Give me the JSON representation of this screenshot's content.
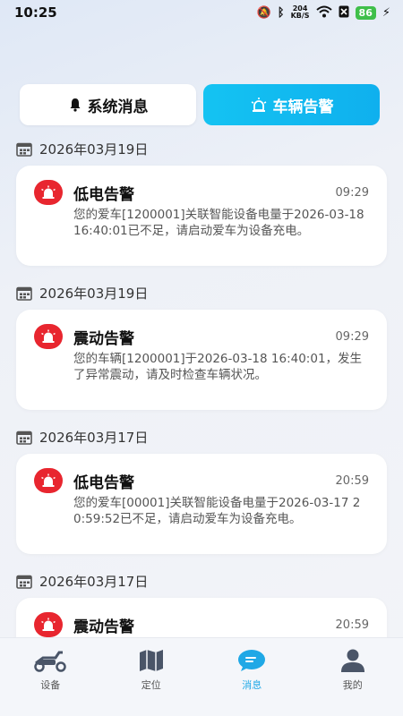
{
  "status": {
    "time": "10:25",
    "net_speed_top": "204",
    "net_speed_bottom": "KB/S",
    "battery": "86"
  },
  "tabs": [
    {
      "label": "系统消息",
      "icon": "bell-icon",
      "active": false
    },
    {
      "label": "车辆告警",
      "icon": "alarm-light-icon",
      "active": true
    }
  ],
  "groups": [
    {
      "date": "2026年03月19日",
      "title": "低电告警",
      "time": "09:29",
      "body": "您的爱车[1200001]关联智能设备电量于2026-03-18 16:40:01已不足，请启动爱车为设备充电。"
    },
    {
      "date": "2026年03月19日",
      "title": "震动告警",
      "time": "09:29",
      "body": "您的车辆[1200001]于2026-03-18 16:40:01，发生了异常震动，请及时检查车辆状况。"
    },
    {
      "date": "2026年03月17日",
      "title": "低电告警",
      "time": "20:59",
      "body": "您的爱车[00001]关联智能设备电量于2026-03-17 20:59:52已不足，请启动爱车为设备充电。"
    },
    {
      "date": "2026年03月17日",
      "title": "震动告警",
      "time": "20:59",
      "body": ""
    }
  ],
  "nav": [
    {
      "label": "设备",
      "icon": "scooter-icon",
      "active": false
    },
    {
      "label": "定位",
      "icon": "map-icon",
      "active": false
    },
    {
      "label": "消息",
      "icon": "message-icon",
      "active": true
    },
    {
      "label": "我的",
      "icon": "user-icon",
      "active": false
    }
  ],
  "colors": {
    "accent": "#14c3f2",
    "alarm": "#e8262f",
    "active_nav": "#1fa8e6"
  }
}
